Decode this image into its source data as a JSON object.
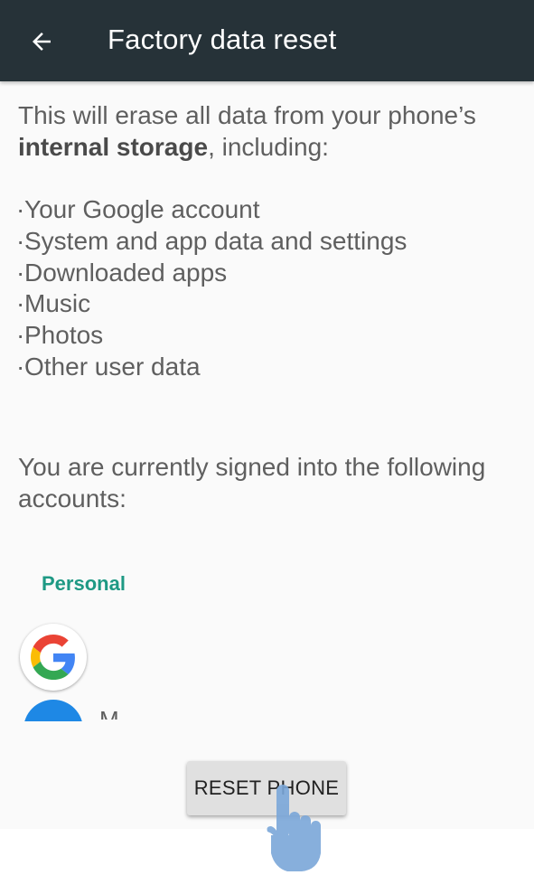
{
  "appbar": {
    "title": "Factory data reset",
    "back_icon": "arrow-back-icon",
    "background": "#263238"
  },
  "intro": {
    "text_before": "This will erase all data from your phone’s ",
    "bold": "internal storage",
    "text_after": ", including:"
  },
  "erase_list": [
    "Your Google account",
    "System and app data and settings",
    "Downloaded apps",
    "Music",
    "Photos",
    "Other user data"
  ],
  "signed_in_text": "You are currently signed into the following accounts:",
  "accounts_section": {
    "header": "Personal",
    "accent": "#1e9984",
    "accounts": [
      {
        "icon": "google-logo-icon"
      },
      {
        "icon": "account-avatar-icon",
        "label_partial": "M"
      }
    ]
  },
  "reset_button": {
    "label": "RESET PHONE"
  },
  "tap_indicator": {
    "icon": "tap-hand-icon",
    "color": "#7ba7d9"
  }
}
